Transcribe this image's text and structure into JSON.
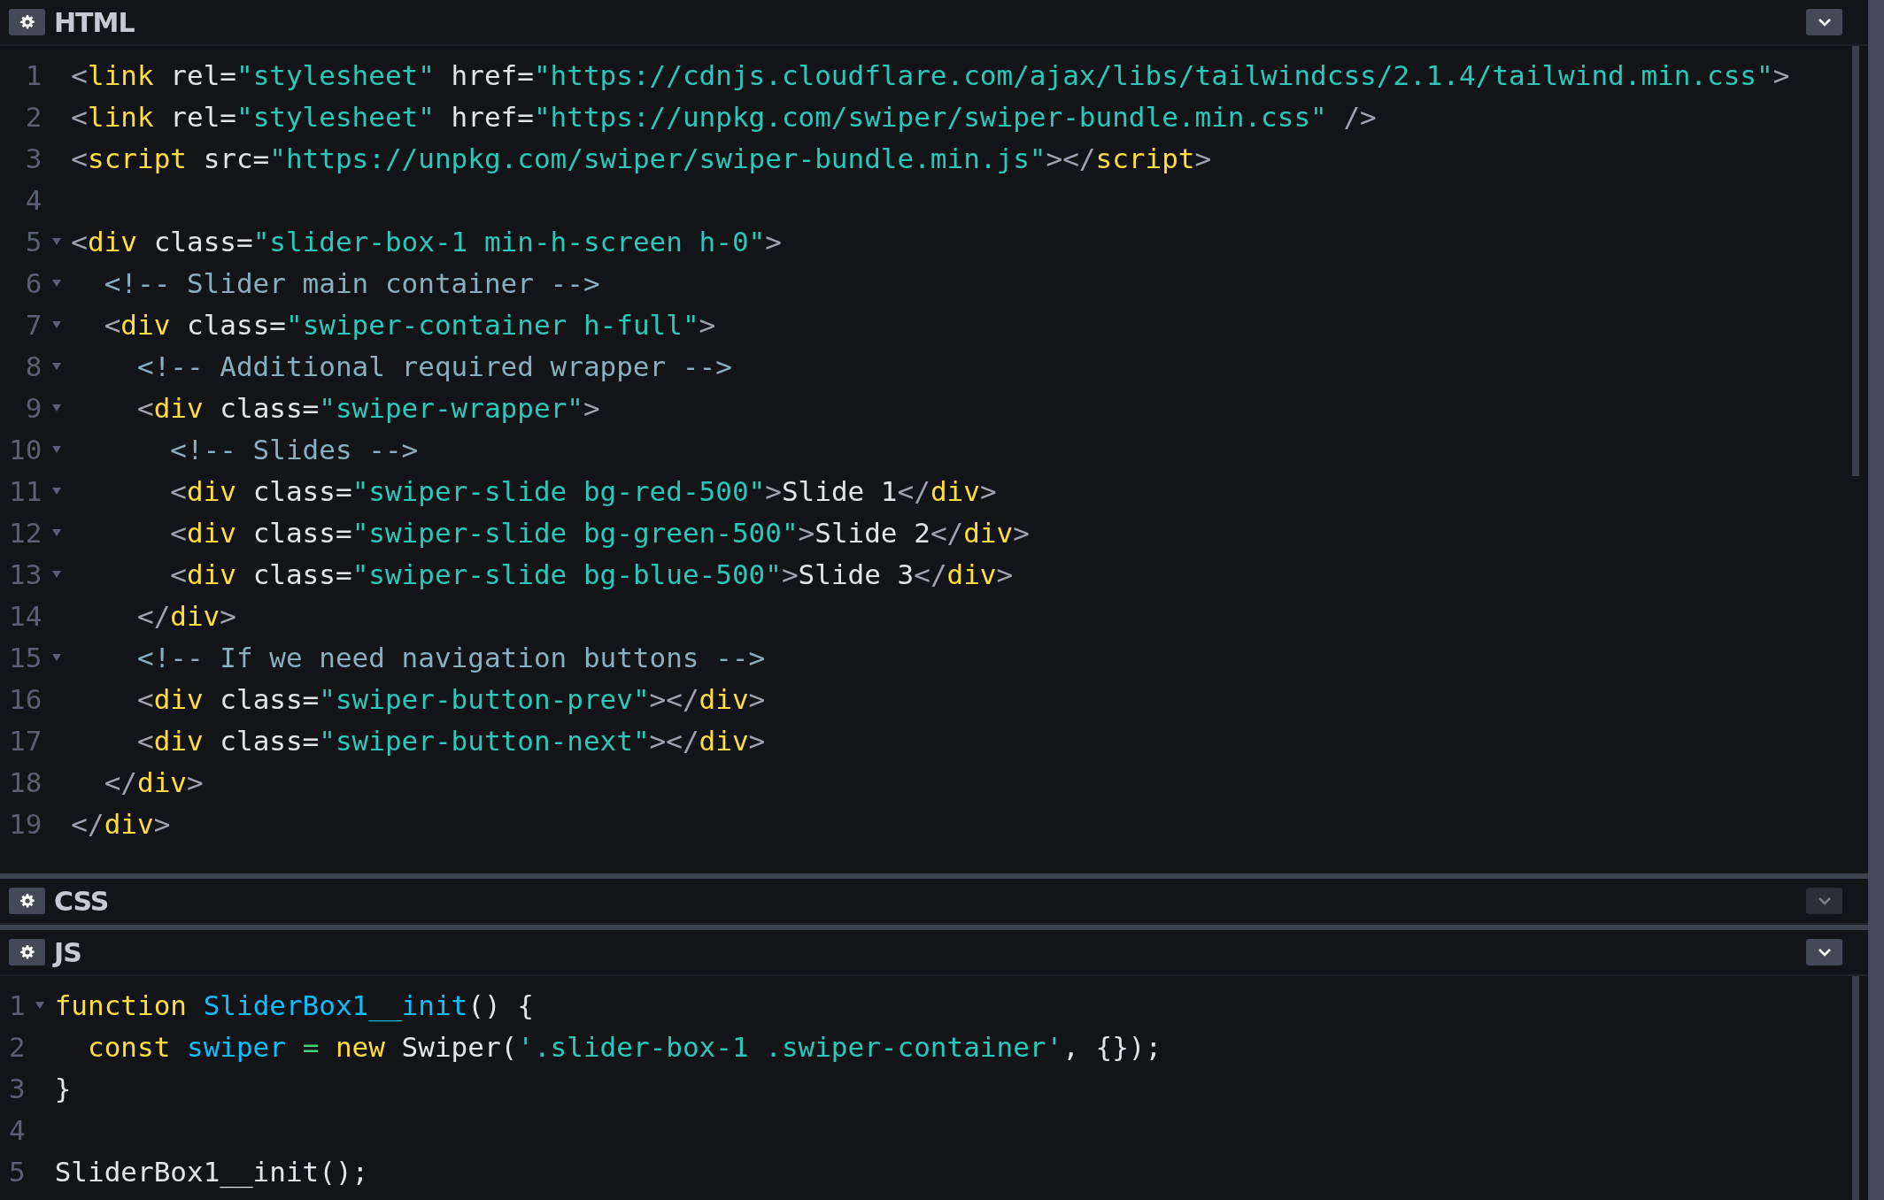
{
  "panels": [
    {
      "title": "HTML",
      "expanded": true,
      "lines": [
        {
          "number": "1",
          "tokens": [
            {
              "kind": "punct",
              "text": "<"
            },
            {
              "kind": "tag",
              "text": "link"
            },
            {
              "kind": "attr",
              "text": " rel="
            },
            {
              "kind": "string",
              "text": "\"stylesheet\""
            },
            {
              "kind": "attr",
              "text": " href="
            },
            {
              "kind": "string",
              "text": "\"https://cdnjs.cloudflare.com/ajax/libs/tailwindcss/2.1.4/tailwind.min.css\""
            },
            {
              "kind": "punct",
              "text": ">"
            }
          ]
        },
        {
          "number": "2",
          "tokens": [
            {
              "kind": "punct",
              "text": "<"
            },
            {
              "kind": "tag",
              "text": "link"
            },
            {
              "kind": "attr",
              "text": " rel="
            },
            {
              "kind": "string",
              "text": "\"stylesheet\""
            },
            {
              "kind": "attr",
              "text": " href="
            },
            {
              "kind": "string",
              "text": "\"https://unpkg.com/swiper/swiper-bundle.min.css\""
            },
            {
              "kind": "punct",
              "text": " />"
            }
          ]
        },
        {
          "number": "3",
          "tokens": [
            {
              "kind": "punct",
              "text": "<"
            },
            {
              "kind": "tag",
              "text": "script"
            },
            {
              "kind": "attr",
              "text": " src="
            },
            {
              "kind": "string",
              "text": "\"https://unpkg.com/swiper/swiper-bundle.min.js\""
            },
            {
              "kind": "punct",
              "text": "></"
            },
            {
              "kind": "tag",
              "text": "script"
            },
            {
              "kind": "punct",
              "text": ">"
            }
          ]
        },
        {
          "number": "4"
        },
        {
          "number": "5",
          "foldable": true,
          "tokens": [
            {
              "kind": "punct",
              "text": "<"
            },
            {
              "kind": "tag",
              "text": "div"
            },
            {
              "kind": "attr",
              "text": " class="
            },
            {
              "kind": "string",
              "text": "\"slider-box-1 min-h-screen h-0\""
            },
            {
              "kind": "punct",
              "text": ">"
            }
          ]
        },
        {
          "number": "6",
          "foldable": true,
          "tokens": [
            {
              "kind": "comment",
              "text": "  <!-- Slider main container -->"
            }
          ]
        },
        {
          "number": "7",
          "foldable": true,
          "tokens": [
            {
              "kind": "punct",
              "text": "  <"
            },
            {
              "kind": "tag",
              "text": "div"
            },
            {
              "kind": "attr",
              "text": " class="
            },
            {
              "kind": "string",
              "text": "\"swiper-container h-full\""
            },
            {
              "kind": "punct",
              "text": ">"
            }
          ]
        },
        {
          "number": "8",
          "foldable": true,
          "tokens": [
            {
              "kind": "comment",
              "text": "    <!-- Additional required wrapper -->"
            }
          ]
        },
        {
          "number": "9",
          "foldable": true,
          "tokens": [
            {
              "kind": "punct",
              "text": "    <"
            },
            {
              "kind": "tag",
              "text": "div"
            },
            {
              "kind": "attr",
              "text": " class="
            },
            {
              "kind": "string",
              "text": "\"swiper-wrapper\""
            },
            {
              "kind": "punct",
              "text": ">"
            }
          ]
        },
        {
          "number": "10",
          "foldable": true,
          "tokens": [
            {
              "kind": "comment",
              "text": "      <!-- Slides -->"
            }
          ]
        },
        {
          "number": "11",
          "foldable": true,
          "tokens": [
            {
              "kind": "punct",
              "text": "      <"
            },
            {
              "kind": "tag",
              "text": "div"
            },
            {
              "kind": "attr",
              "text": " class="
            },
            {
              "kind": "string",
              "text": "\"swiper-slide bg-red-500\""
            },
            {
              "kind": "punct",
              "text": ">"
            },
            {
              "kind": "plain",
              "text": "Slide 1"
            },
            {
              "kind": "punct",
              "text": "</"
            },
            {
              "kind": "tag",
              "text": "div"
            },
            {
              "kind": "punct",
              "text": ">"
            }
          ]
        },
        {
          "number": "12",
          "foldable": true,
          "tokens": [
            {
              "kind": "punct",
              "text": "      <"
            },
            {
              "kind": "tag",
              "text": "div"
            },
            {
              "kind": "attr",
              "text": " class="
            },
            {
              "kind": "string",
              "text": "\"swiper-slide bg-green-500\""
            },
            {
              "kind": "punct",
              "text": ">"
            },
            {
              "kind": "plain",
              "text": "Slide 2"
            },
            {
              "kind": "punct",
              "text": "</"
            },
            {
              "kind": "tag",
              "text": "div"
            },
            {
              "kind": "punct",
              "text": ">"
            }
          ]
        },
        {
          "number": "13",
          "foldable": true,
          "tokens": [
            {
              "kind": "punct",
              "text": "      <"
            },
            {
              "kind": "tag",
              "text": "div"
            },
            {
              "kind": "attr",
              "text": " class="
            },
            {
              "kind": "string",
              "text": "\"swiper-slide bg-blue-500\""
            },
            {
              "kind": "punct",
              "text": ">"
            },
            {
              "kind": "plain",
              "text": "Slide 3"
            },
            {
              "kind": "punct",
              "text": "</"
            },
            {
              "kind": "tag",
              "text": "div"
            },
            {
              "kind": "punct",
              "text": ">"
            }
          ]
        },
        {
          "number": "14",
          "tokens": [
            {
              "kind": "punct",
              "text": "    </"
            },
            {
              "kind": "tag",
              "text": "div"
            },
            {
              "kind": "punct",
              "text": ">"
            }
          ]
        },
        {
          "number": "15",
          "foldable": true,
          "tokens": [
            {
              "kind": "comment",
              "text": "    <!-- If we need navigation buttons -->"
            }
          ]
        },
        {
          "number": "16",
          "tokens": [
            {
              "kind": "punct",
              "text": "    <"
            },
            {
              "kind": "tag",
              "text": "div"
            },
            {
              "kind": "attr",
              "text": " class="
            },
            {
              "kind": "string",
              "text": "\"swiper-button-prev\""
            },
            {
              "kind": "punct",
              "text": "></"
            },
            {
              "kind": "tag",
              "text": "div"
            },
            {
              "kind": "punct",
              "text": ">"
            }
          ]
        },
        {
          "number": "17",
          "tokens": [
            {
              "kind": "punct",
              "text": "    <"
            },
            {
              "kind": "tag",
              "text": "div"
            },
            {
              "kind": "attr",
              "text": " class="
            },
            {
              "kind": "string",
              "text": "\"swiper-button-next\""
            },
            {
              "kind": "punct",
              "text": "></"
            },
            {
              "kind": "tag",
              "text": "div"
            },
            {
              "kind": "punct",
              "text": ">"
            }
          ]
        },
        {
          "number": "18",
          "tokens": [
            {
              "kind": "punct",
              "text": "  </"
            },
            {
              "kind": "tag",
              "text": "div"
            },
            {
              "kind": "punct",
              "text": ">"
            }
          ]
        },
        {
          "number": "19",
          "tokens": [
            {
              "kind": "punct",
              "text": "</"
            },
            {
              "kind": "tag",
              "text": "div"
            },
            {
              "kind": "punct",
              "text": ">"
            }
          ]
        }
      ]
    },
    {
      "title": "CSS",
      "expanded": false
    },
    {
      "title": "JS",
      "expanded": true,
      "lines": [
        {
          "number": "1",
          "foldable": true,
          "tokens": [
            {
              "kind": "keyword",
              "text": "function "
            },
            {
              "kind": "def",
              "text": "SliderBox1__init"
            },
            {
              "kind": "plain",
              "text": "() {"
            }
          ]
        },
        {
          "number": "2",
          "tokens": [
            {
              "kind": "keyword",
              "text": "  const "
            },
            {
              "kind": "def",
              "text": "swiper "
            },
            {
              "kind": "operator",
              "text": "= "
            },
            {
              "kind": "keyword",
              "text": "new"
            },
            {
              "kind": "plain",
              "text": " Swiper("
            },
            {
              "kind": "string",
              "text": "'.slider-box-1 .swiper-container'"
            },
            {
              "kind": "plain",
              "text": ", {});"
            }
          ]
        },
        {
          "number": "3",
          "tokens": [
            {
              "kind": "plain",
              "text": "}"
            }
          ]
        },
        {
          "number": "4"
        },
        {
          "number": "5",
          "tokens": [
            {
              "kind": "plain",
              "text": "SliderBox1__init();"
            }
          ]
        }
      ]
    }
  ]
}
